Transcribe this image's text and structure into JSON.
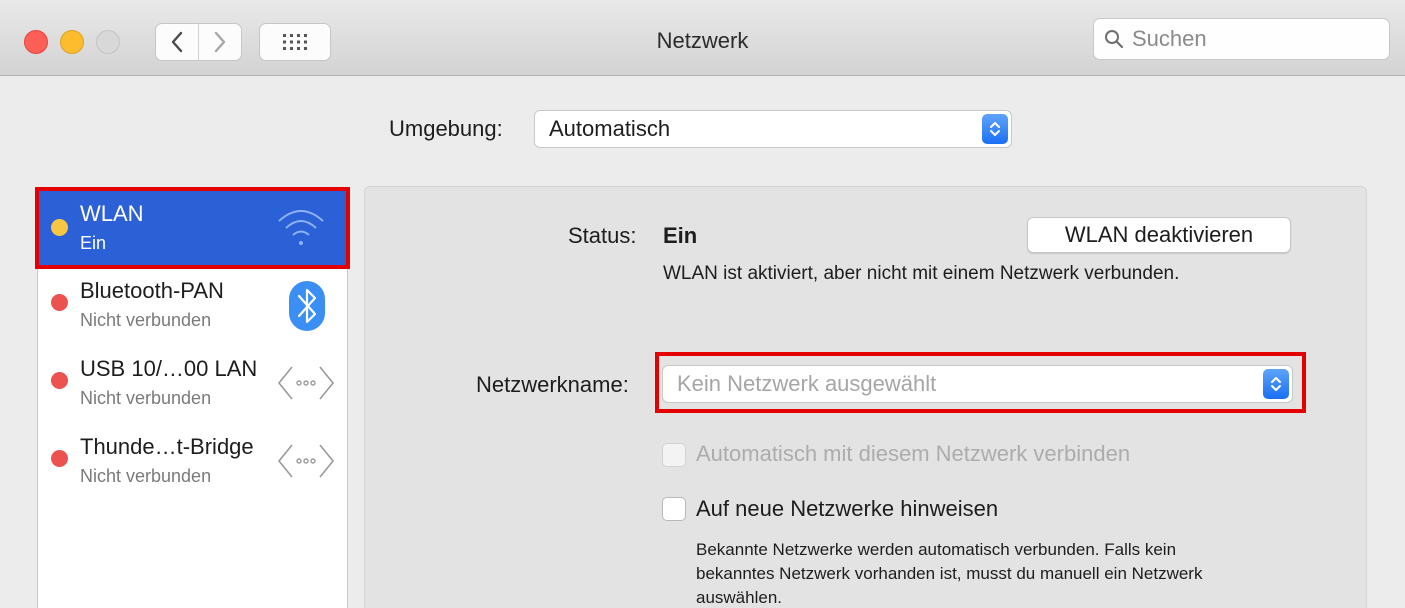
{
  "window": {
    "title": "Netzwerk"
  },
  "toolbar": {
    "back_icon": "chevron-left-icon",
    "forward_icon": "chevron-right-icon",
    "grid_icon": "grid-icon",
    "search_placeholder": "Suchen"
  },
  "location": {
    "label": "Umgebung:",
    "value": "Automatisch"
  },
  "services": [
    {
      "name": "WLAN",
      "status": "Ein",
      "dot_color": "#f7c644",
      "icon": "wifi-icon",
      "selected": true
    },
    {
      "name": "Bluetooth-PAN",
      "status": "Nicht verbunden",
      "dot_color": "#ec5250",
      "icon": "bluetooth-icon",
      "selected": false
    },
    {
      "name": "USB 10/…00 LAN",
      "status": "Nicht verbunden",
      "dot_color": "#ec5250",
      "icon": "ethernet-icon",
      "selected": false
    },
    {
      "name": "Thunde…t-Bridge",
      "status": "Nicht verbunden",
      "dot_color": "#ec5250",
      "icon": "ethernet-icon",
      "selected": false
    }
  ],
  "detail": {
    "status_label": "Status:",
    "status_value": "Ein",
    "toggle_button": "WLAN deaktivieren",
    "status_description": "WLAN ist aktiviert, aber nicht mit einem Netzwerk verbunden.",
    "network_name_label": "Netzwerkname:",
    "network_name_placeholder": "Kein Netzwerk ausgewählt",
    "auto_join_label": "Automatisch mit diesem Netzwerk verbinden",
    "ask_join_label": "Auf neue Netzwerke hinweisen",
    "ask_join_description_1": "Bekannte Netzwerke werden automatisch verbunden. Falls kein",
    "ask_join_description_2": "bekanntes Netzwerk vorhanden ist, musst du manuell ein Netzwerk",
    "ask_join_description_3": "auswählen."
  },
  "colors": {
    "accent": "#2b60d6",
    "highlight_box": "#e30000",
    "stepper": "#1a6ff4"
  }
}
